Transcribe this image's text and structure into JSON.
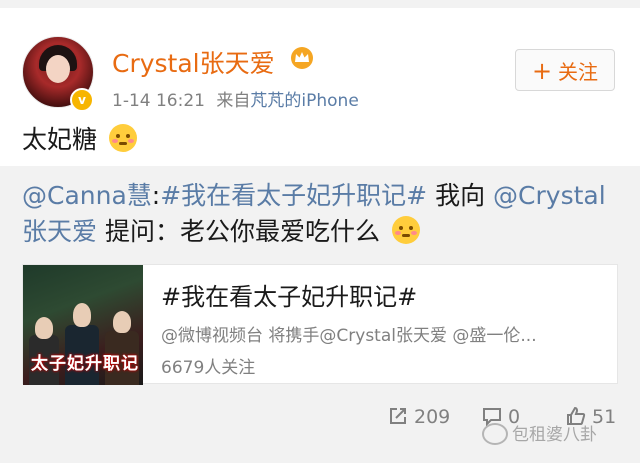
{
  "user": {
    "name": "Crystal张天爱",
    "time": "1-14 16:21",
    "source_prefix": "来自",
    "source_device": "芃芃的iPhone",
    "verified_badge": "v"
  },
  "follow_button": {
    "plus": "+",
    "label": "关注"
  },
  "post": {
    "text": "太妃糖"
  },
  "repost": {
    "mention1": "@Canna慧",
    "colon": ":",
    "topic": "#我在看太子妃升职记#",
    "mid_text": " 我向 ",
    "mention2": "@Crystal张天爱",
    "tail_text": " 提问：老公你最爱吃什么"
  },
  "card": {
    "thumbnail_title": "太子妃升职记",
    "title": "#我在看太子妃升职记#",
    "description": "@微博视频台 将携手@Crystal张天爱 @盛一伦...",
    "stat": "6679人关注"
  },
  "actions": {
    "reposts": "209",
    "comments": "0",
    "likes": "51"
  },
  "watermark": "包租婆八卦",
  "colors": {
    "name": "#e86b12",
    "link": "#5a7ca6",
    "meta": "#808080",
    "badge": "#f7b500"
  }
}
